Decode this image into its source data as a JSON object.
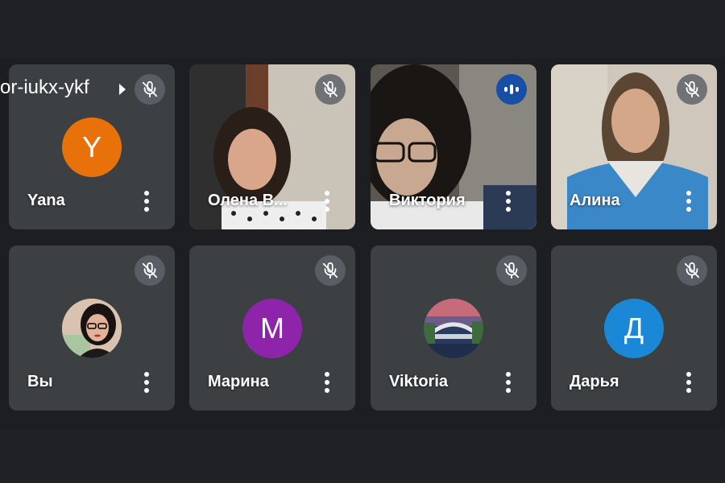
{
  "meeting": {
    "code": "or-iukx-ykf"
  },
  "participants": [
    {
      "name": "Yana",
      "initial": "Y",
      "avatar_color": "#e8710a",
      "state": "muted",
      "type": "initial"
    },
    {
      "name": "Олена В...",
      "state": "muted",
      "type": "video"
    },
    {
      "name": "Виктория",
      "state": "speaking",
      "type": "video"
    },
    {
      "name": "Алина",
      "state": "muted",
      "type": "video"
    },
    {
      "name": "Вы",
      "state": "muted",
      "type": "photo"
    },
    {
      "name": "Марина",
      "initial": "М",
      "avatar_color": "#8e24aa",
      "state": "muted",
      "type": "initial"
    },
    {
      "name": "Viktoria",
      "state": "muted",
      "type": "photo"
    },
    {
      "name": "Дарья",
      "initial": "Д",
      "avatar_color": "#1a88d6",
      "state": "muted",
      "type": "initial"
    }
  ],
  "icons": {
    "mic_off": "mic-off-icon",
    "speaking": "audio-level-icon",
    "more": "more-vert-icon",
    "arrow": "chevron-right-icon"
  },
  "colors": {
    "tile_bg": "#3c4043",
    "page_bg": "#1d1e21",
    "speaking_accent": "#174ea6"
  }
}
